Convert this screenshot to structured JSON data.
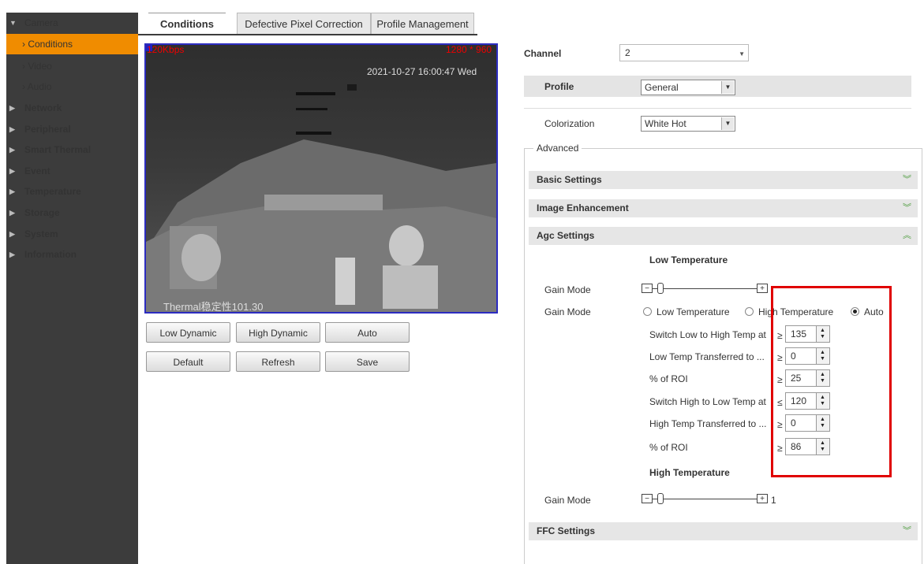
{
  "sidebar": {
    "camera": "Camera",
    "subitems": [
      "Conditions",
      "Video",
      "Audio"
    ],
    "items": [
      "Network",
      "Peripheral",
      "Smart Thermal",
      "Event",
      "Temperature",
      "Storage",
      "System",
      "Information"
    ]
  },
  "tabs": [
    "Conditions",
    "Defective Pixel Correction",
    "Profile Management"
  ],
  "video": {
    "bitrate": "120Kbps",
    "resolution": "1280 * 960",
    "timestamp": "2021-10-27 16:00:47 Wed",
    "osd": "Thermal稳定性101.30"
  },
  "buttons": {
    "low_dynamic": "Low Dynamic",
    "high_dynamic": "High Dynamic",
    "auto": "Auto",
    "default": "Default",
    "refresh": "Refresh",
    "save": "Save"
  },
  "channel": {
    "label": "Channel",
    "value": "2"
  },
  "profile": {
    "label": "Profile",
    "value": "General"
  },
  "colorization": {
    "label": "Colorization",
    "value": "White Hot"
  },
  "advanced": "Advanced",
  "sections": {
    "basic": "Basic Settings",
    "enhancement": "Image Enhancement",
    "agc": "Agc Settings",
    "ffc": "FFC Settings"
  },
  "agc": {
    "low_temp_title": "Low Temperature",
    "high_temp_title": "High Temperature",
    "gain_mode_label": "Gain Mode",
    "radio_low": "Low Temperature",
    "radio_high": "High Temperature",
    "radio_auto": "Auto",
    "selected_radio": "Auto",
    "high_slider_value": "1",
    "rows": [
      {
        "label": "Switch Low to High Temp at",
        "op": "≥",
        "value": "135"
      },
      {
        "label": "Low Temp Transferred to ...",
        "op": "≥",
        "value": "0"
      },
      {
        "label": "% of ROI",
        "op": "≥",
        "value": "25"
      },
      {
        "label": "Switch High to Low Temp at",
        "op": "≤",
        "value": "120"
      },
      {
        "label": "High Temp Transferred to ...",
        "op": "≥",
        "value": "0"
      },
      {
        "label": "% of ROI",
        "op": "≥",
        "value": "86"
      }
    ]
  },
  "colors": {
    "accent": "#f08c00",
    "highlight": "#e00000",
    "sidebar": "#3c3c3c"
  }
}
